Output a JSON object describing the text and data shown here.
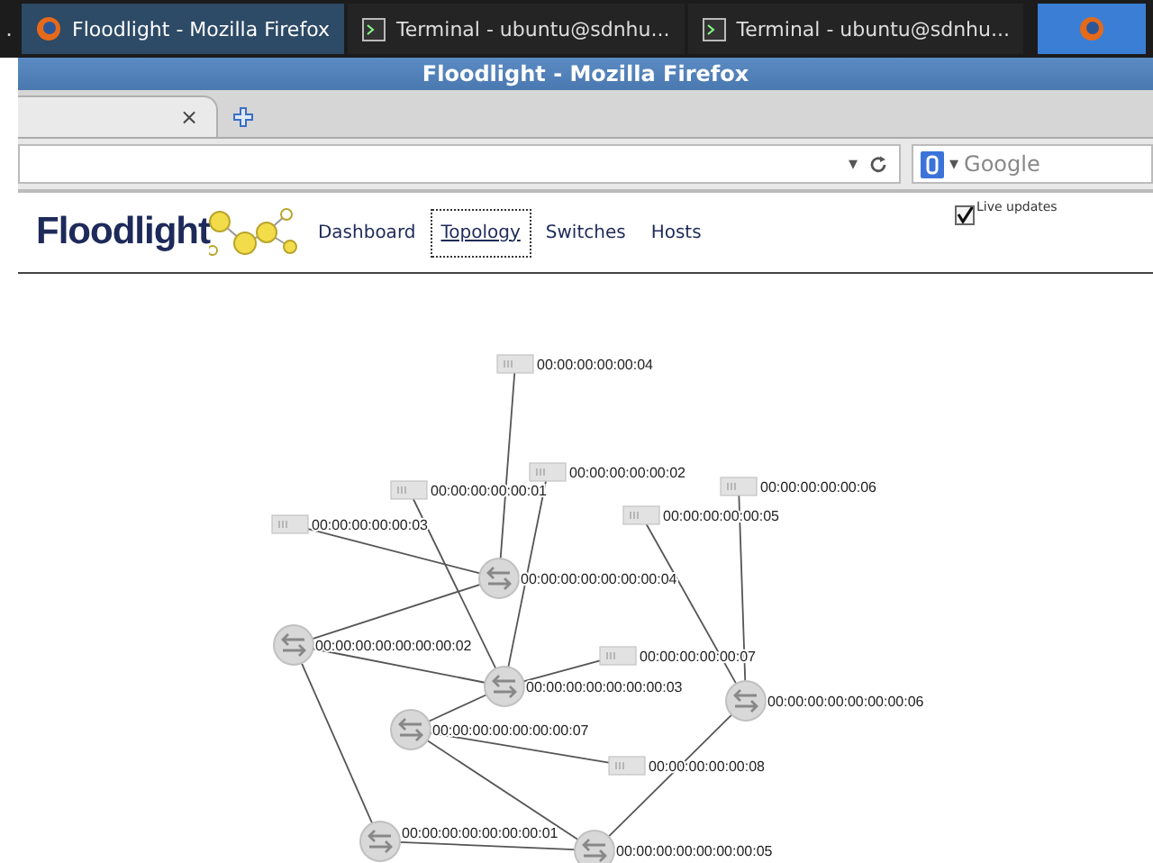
{
  "taskbar": {
    "leading": ".",
    "tasks": [
      {
        "title": "Floodlight - Mozilla Firefox",
        "kind": "firefox",
        "selected": true
      },
      {
        "title": "Terminal - ubuntu@sdnhu...",
        "kind": "terminal",
        "selected": false
      },
      {
        "title": "Terminal - ubuntu@sdnhu...",
        "kind": "terminal",
        "selected": false
      }
    ]
  },
  "window": {
    "title": "Floodlight - Mozilla Firefox"
  },
  "tab_bar": {
    "close": "×"
  },
  "nav_bar": {
    "dropdown": "▾",
    "search": {
      "engine_dropdown": "▾",
      "placeholder": "Google"
    }
  },
  "page": {
    "logo": "Floodlight",
    "nav": [
      {
        "label": "Dashboard",
        "selected": false
      },
      {
        "label": "Topology",
        "selected": true
      },
      {
        "label": "Switches",
        "selected": false
      },
      {
        "label": "Hosts",
        "selected": false
      }
    ],
    "live_updates": {
      "label": "Live updates",
      "checked": true
    },
    "topology": {
      "nodes": [
        {
          "kind": "host",
          "label": "00:00:00:00:00:04"
        },
        {
          "kind": "host",
          "label": "00:00:00:00:00:01"
        },
        {
          "kind": "host",
          "label": "00:00:00:00:00:02"
        },
        {
          "kind": "host",
          "label": "00:00:00:00:00:03"
        },
        {
          "kind": "host",
          "label": "00:00:00:00:00:05"
        },
        {
          "kind": "host",
          "label": "00:00:00:00:00:06"
        },
        {
          "kind": "host",
          "label": "00:00:00:00:00:07"
        },
        {
          "kind": "host",
          "label": "00:00:00:00:00:08"
        },
        {
          "kind": "switch",
          "label": "00:00:00:00:00:00:00:04"
        },
        {
          "kind": "switch",
          "label": "00:00:00:00:00:00:00:02"
        },
        {
          "kind": "switch",
          "label": "00:00:00:00:00:00:00:03"
        },
        {
          "kind": "switch",
          "label": "00:00:00:00:00:00:00:06"
        },
        {
          "kind": "switch",
          "label": "00:00:00:00:00:00:00:07"
        },
        {
          "kind": "switch",
          "label": "00:00:00:00:00:00:00:01"
        },
        {
          "kind": "switch",
          "label": "00:00:00:00:00:00:00:05"
        }
      ]
    }
  }
}
